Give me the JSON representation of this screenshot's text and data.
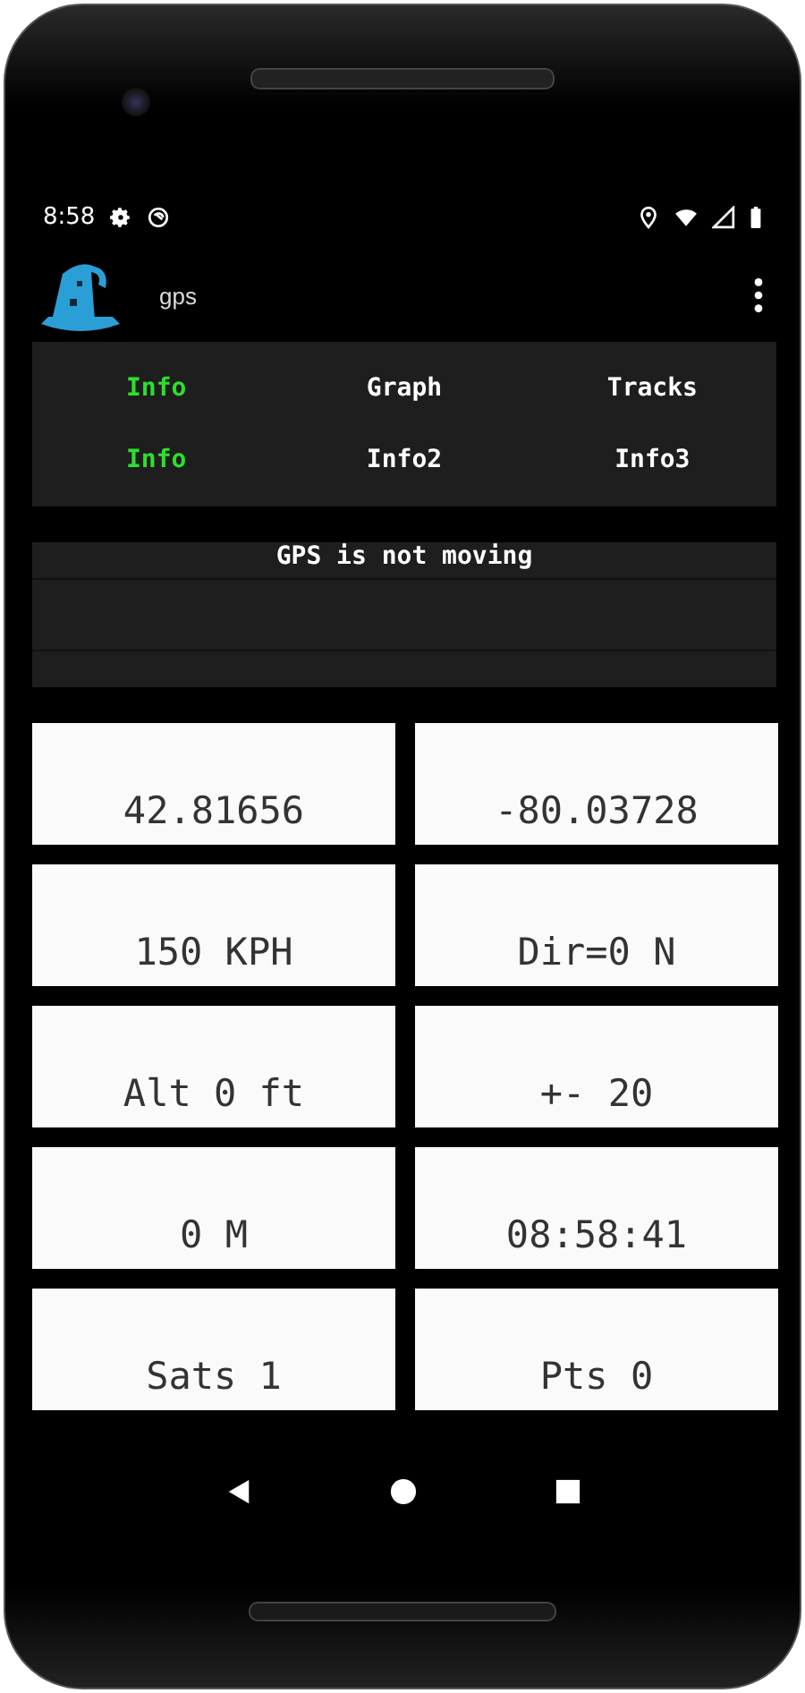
{
  "status_bar": {
    "time": "8:58"
  },
  "app_bar": {
    "title": "gps"
  },
  "tab_rows": [
    [
      {
        "label": "Info",
        "selected": true
      },
      {
        "label": "Graph",
        "selected": false
      },
      {
        "label": "Tracks",
        "selected": false
      }
    ],
    [
      {
        "label": "Info",
        "selected": true
      },
      {
        "label": "Info2",
        "selected": false
      },
      {
        "label": "Info3",
        "selected": false
      }
    ]
  ],
  "message": {
    "text": "GPS is not moving"
  },
  "readings": [
    "42.81656",
    "-80.03728",
    "150 KPH",
    "Dir=0 N",
    "Alt 0 ft",
    "+- 20",
    "0 M",
    "08:58:41",
    "Sats 1",
    "Pts 0"
  ]
}
